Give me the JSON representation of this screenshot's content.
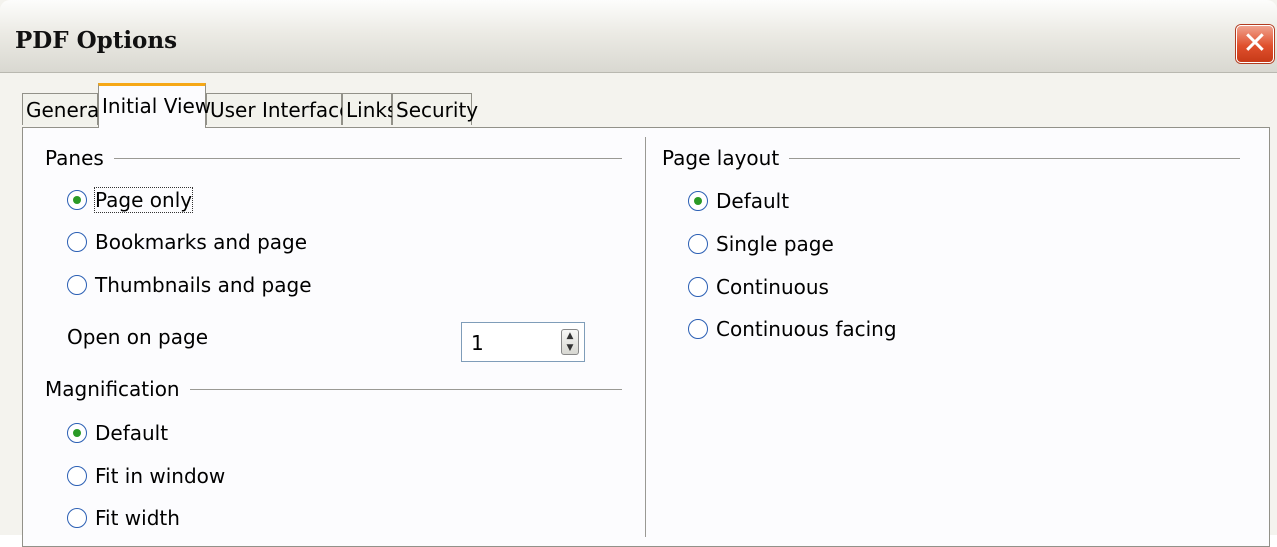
{
  "window": {
    "title": "PDF Options"
  },
  "tabs": [
    "General",
    "Initial View",
    "User Interface",
    "Links",
    "Security"
  ],
  "active_tab": "Initial View",
  "panes": {
    "label": "Panes",
    "options": [
      "Page only",
      "Bookmarks and page",
      "Thumbnails and page"
    ],
    "selected": "Page only",
    "open_on_page_label": "Open on page",
    "open_on_page_value": "1"
  },
  "magnification": {
    "label": "Magnification",
    "options": [
      "Default",
      "Fit in window",
      "Fit width"
    ],
    "selected": "Default"
  },
  "page_layout": {
    "label": "Page layout",
    "options": [
      "Default",
      "Single page",
      "Continuous",
      "Continuous facing"
    ],
    "selected": "Default"
  },
  "colors": {
    "tab_accent": "#f6a816",
    "close_button": "#e0502d",
    "radio_dot": "#2a9a26"
  },
  "icons": {
    "close": "close-icon",
    "spin_up": "chevron-up-icon",
    "spin_down": "chevron-down-icon"
  }
}
